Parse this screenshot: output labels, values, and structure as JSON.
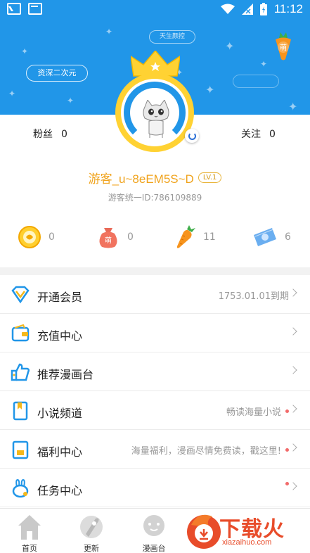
{
  "status_bar": {
    "time": "11:12"
  },
  "header": {
    "title_badge": "资深二次元",
    "top_badge": "天生颜控",
    "carrot_badge": "萌"
  },
  "profile": {
    "fans_label": "粉丝",
    "fans_count": "0",
    "follow_label": "关注",
    "follow_count": "0",
    "username": "游客_u~8eEM5S~D",
    "level": "LV.1",
    "uid": "游客统一ID:786109889"
  },
  "stats": [
    {
      "icon": "gold-coin-icon",
      "value": "0"
    },
    {
      "icon": "meng-bag-icon",
      "value": "0"
    },
    {
      "icon": "carrot-icon",
      "value": "11"
    },
    {
      "icon": "ticket-icon",
      "value": "6"
    }
  ],
  "menu": [
    {
      "icon": "vip-diamond-icon",
      "label": "开通会员",
      "right": "1753.01.01到期",
      "dot": false
    },
    {
      "icon": "wallet-icon",
      "label": "充值中心",
      "right": "",
      "dot": false
    },
    {
      "icon": "thumbs-up-icon",
      "label": "推荐漫画台",
      "right": "",
      "dot": false
    },
    {
      "icon": "book-icon",
      "label": "小说频道",
      "right": "畅读海量小说",
      "dot": true
    },
    {
      "icon": "gift-card-icon",
      "label": "福利中心",
      "right": "海量福利，漫画尽情免费读，戳这里!",
      "dot": true
    },
    {
      "icon": "rabbit-icon",
      "label": "任务中心",
      "right": "",
      "dot": true
    }
  ],
  "bottom_nav": [
    {
      "icon": "home-icon",
      "label": "首页"
    },
    {
      "icon": "rocket-icon",
      "label": "更新"
    },
    {
      "icon": "planet-icon",
      "label": "漫画台"
    }
  ],
  "watermark": {
    "text": "下载火",
    "sub": "xiazaihuo.com"
  },
  "colors": {
    "primary": "#2196e8",
    "gold": "#f0a31c",
    "accent_red": "#e84c2a"
  }
}
